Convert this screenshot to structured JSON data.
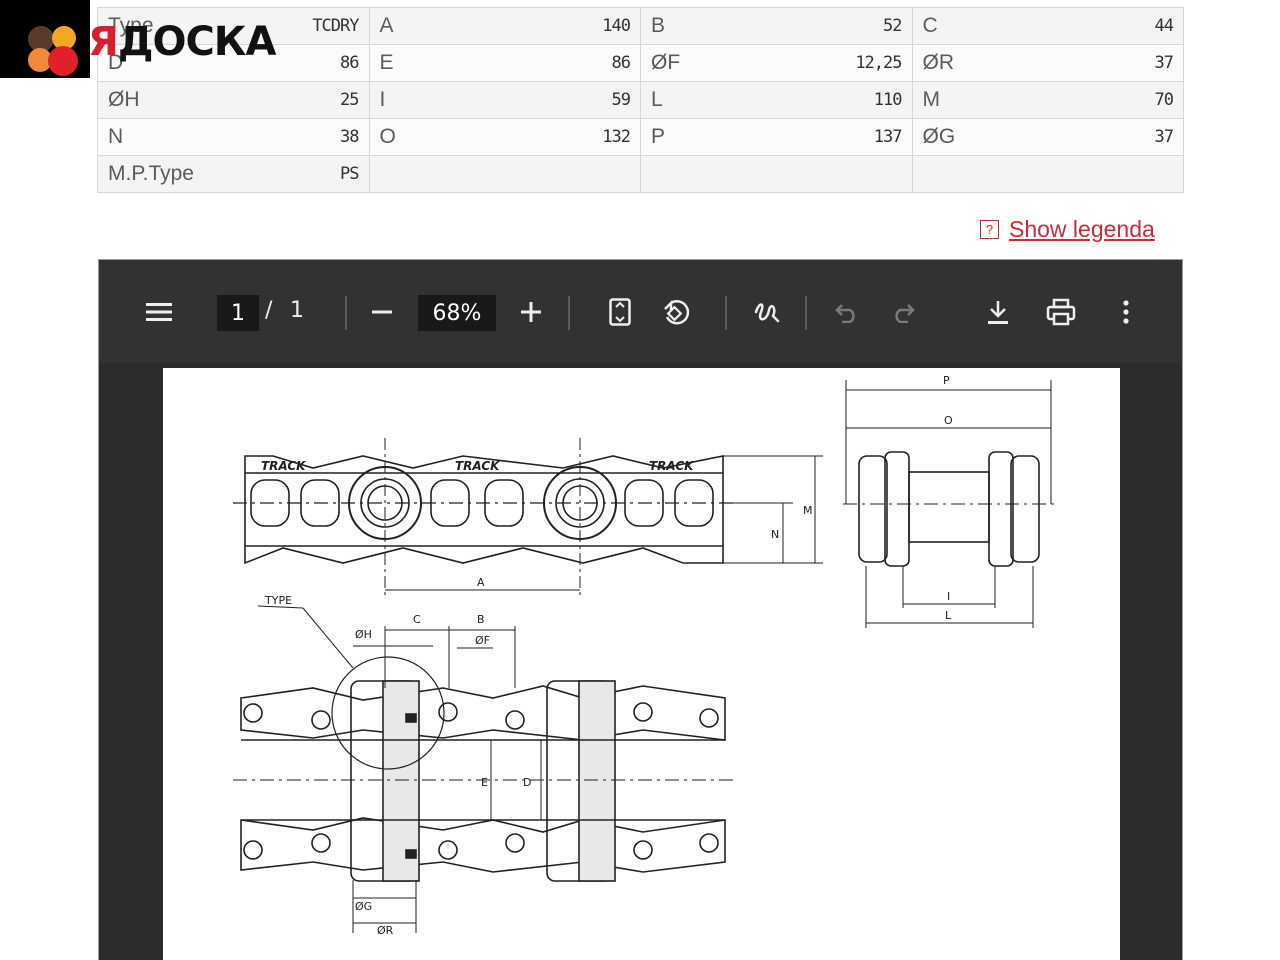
{
  "logo": {
    "text_first": "Я",
    "text_rest": "ДОСКА"
  },
  "spec_rows": [
    [
      {
        "label": "Type",
        "value": "TCDRY"
      },
      {
        "label": "A",
        "value": "140"
      },
      {
        "label": "B",
        "value": "52"
      },
      {
        "label": "C",
        "value": "44"
      }
    ],
    [
      {
        "label": "D",
        "value": "86"
      },
      {
        "label": "E",
        "value": "86"
      },
      {
        "label": "ØF",
        "value": "12,25"
      },
      {
        "label": "ØR",
        "value": "37"
      }
    ],
    [
      {
        "label": "ØH",
        "value": "25"
      },
      {
        "label": "I",
        "value": "59"
      },
      {
        "label": "L",
        "value": "110"
      },
      {
        "label": "M",
        "value": "70"
      }
    ],
    [
      {
        "label": "N",
        "value": "38"
      },
      {
        "label": "O",
        "value": "132"
      },
      {
        "label": "P",
        "value": "137"
      },
      {
        "label": "ØG",
        "value": "37"
      }
    ],
    [
      {
        "label": "M.P.Type",
        "value": "PS"
      },
      {
        "label": "",
        "value": ""
      },
      {
        "label": "",
        "value": ""
      },
      {
        "label": "",
        "value": ""
      }
    ]
  ],
  "legend": {
    "icon": "?",
    "label": "Show legenda"
  },
  "viewer": {
    "page_current": "1",
    "page_separator": "/",
    "page_total": "1",
    "zoom": "68%",
    "icons": [
      "menu-icon",
      "zoom-out-icon",
      "zoom-in-icon",
      "fit-page-icon",
      "rotate-icon",
      "annotate-icon",
      "undo-icon",
      "redo-icon",
      "download-icon",
      "print-icon",
      "more-icon"
    ]
  },
  "drawing": {
    "brand": "TRACK",
    "labels": {
      "P": "P",
      "O": "O",
      "M": "M",
      "N": "N",
      "A": "A",
      "I": "I",
      "L": "L",
      "type": "TYPE",
      "C": "C",
      "B": "B",
      "OH": "ØH",
      "OF": "ØF",
      "E": "E",
      "D": "D",
      "OG": "ØG",
      "OR": "ØR"
    }
  }
}
